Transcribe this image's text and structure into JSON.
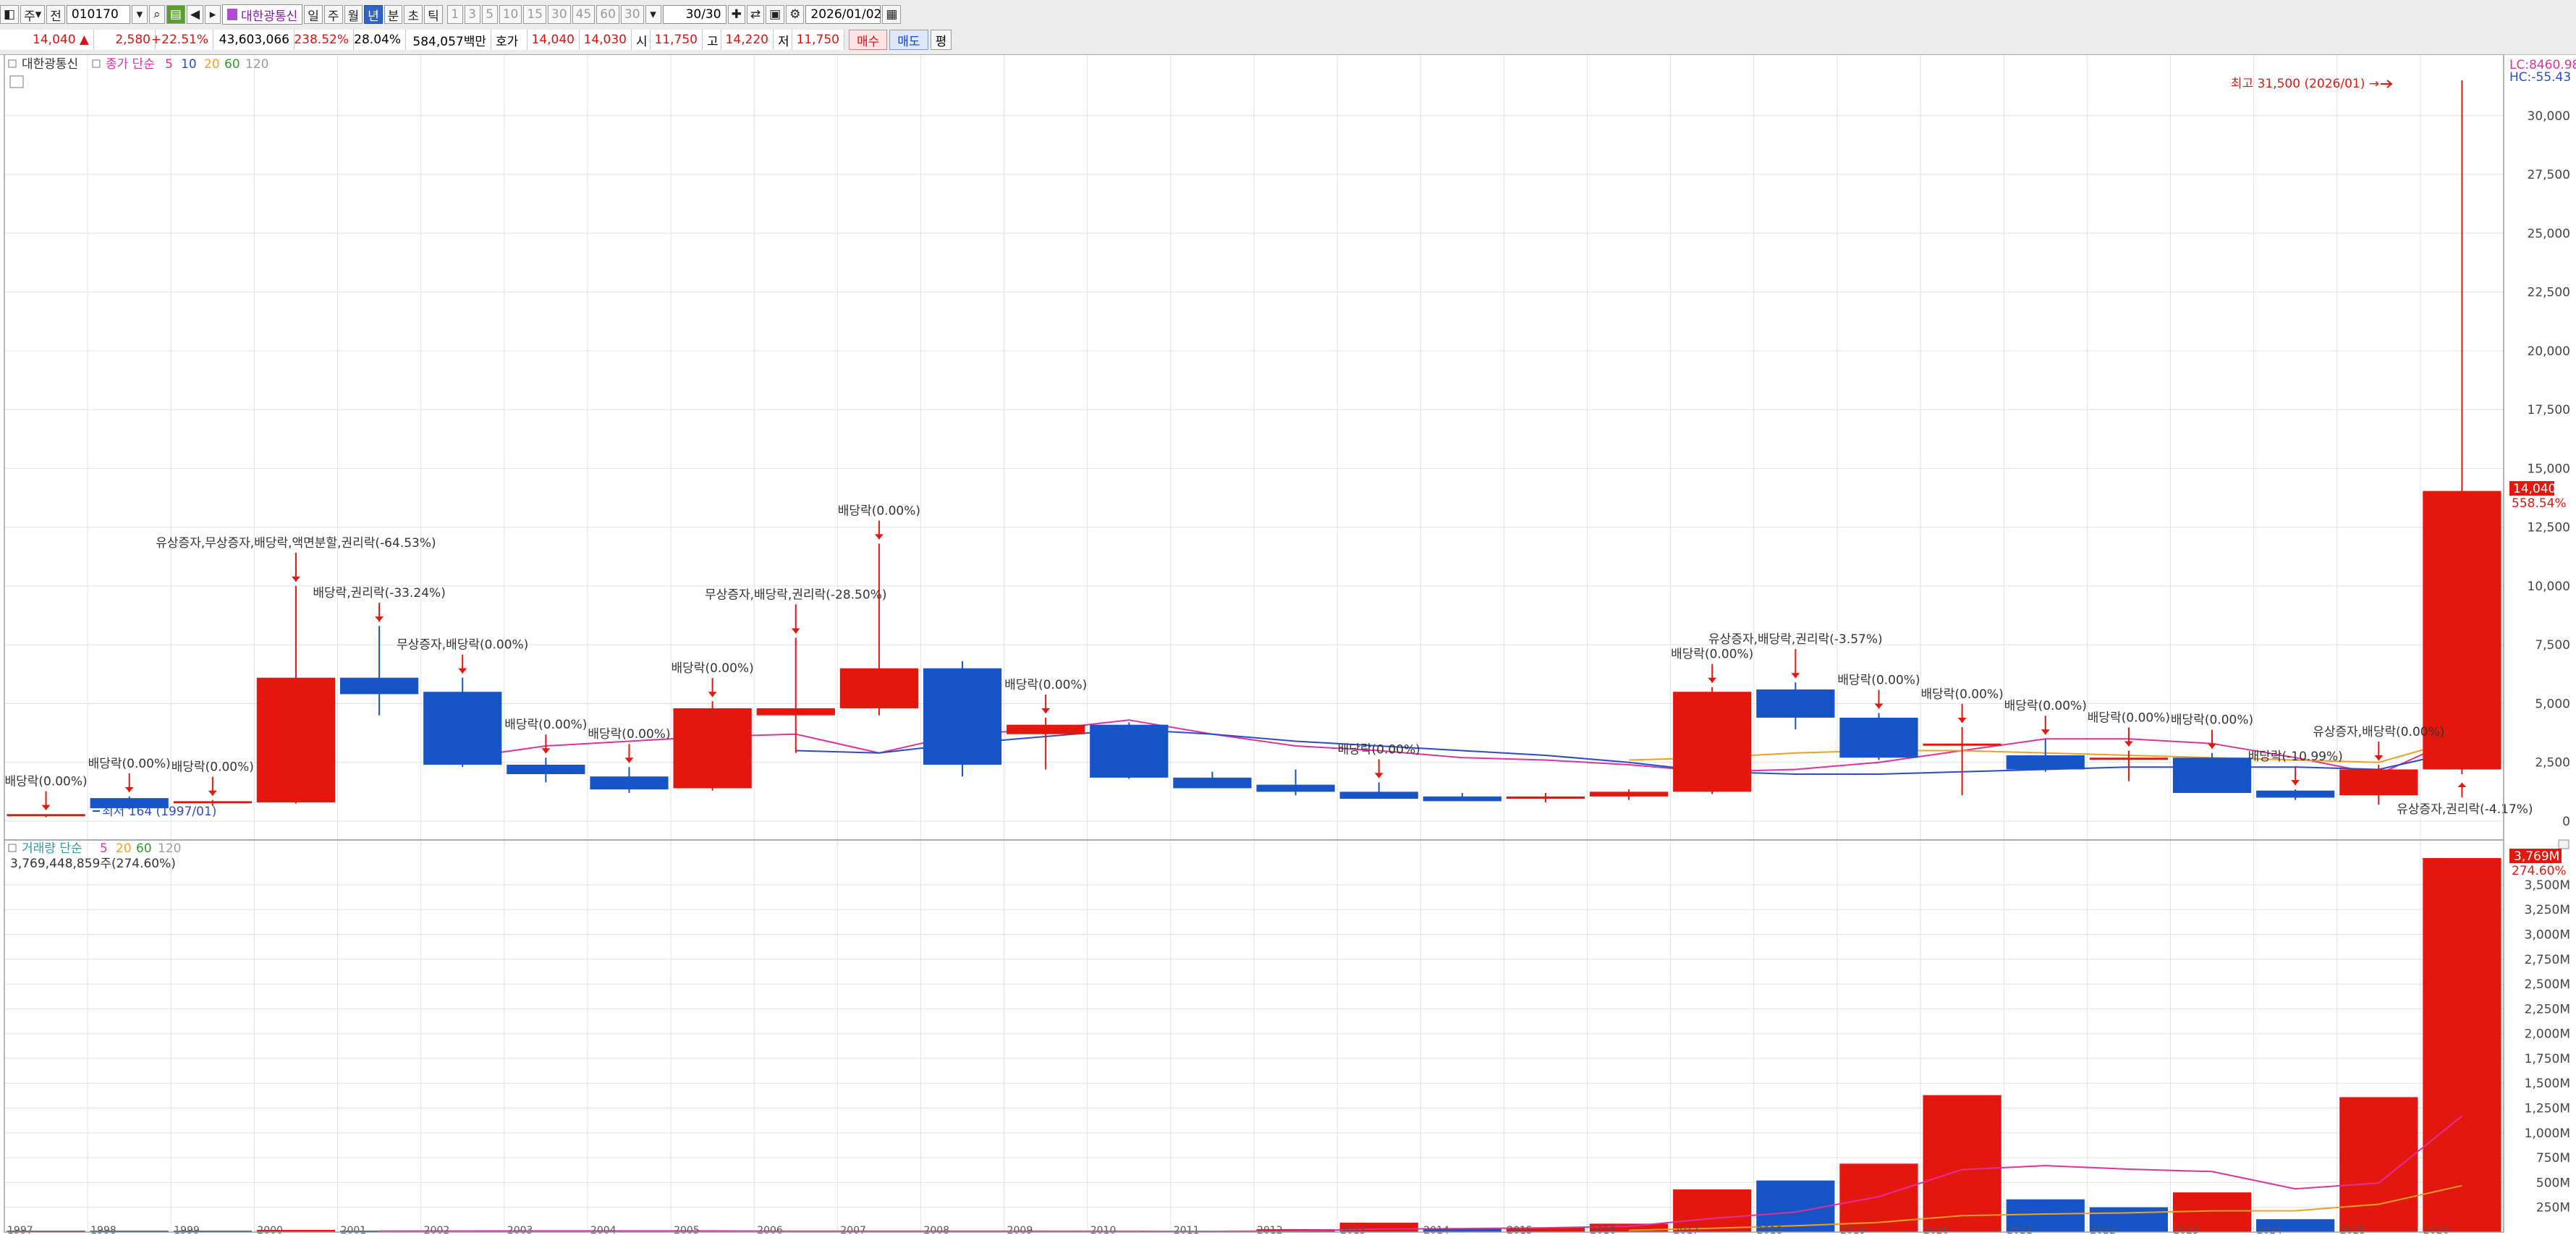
{
  "toolbar": {
    "period_unit": "주",
    "prev": "전",
    "code": "010170",
    "stock_name": "대한광통신",
    "intervals": [
      "일",
      "주",
      "월",
      "년",
      "분",
      "초",
      "틱"
    ],
    "active_interval": "년",
    "counts": [
      "1",
      "3",
      "5",
      "10",
      "15",
      "30",
      "45",
      "60",
      "30"
    ],
    "count_field": "30/30",
    "date": "2026/01/02"
  },
  "quote": {
    "price": "14,040 ▲",
    "change": "2,580",
    "change_pct": "+22.51%",
    "volume": "43,603,066",
    "volume_pct": "238.52%",
    "turnover": "28.04%",
    "amount": "584,057백만",
    "bid_label": "호가",
    "ask": "14,040",
    "bid": "14,030",
    "open_label": "시",
    "open": "11,750",
    "high_label": "고",
    "high": "14,220",
    "low_label": "저",
    "low": "11,750",
    "buy": "매수",
    "sell": "매도",
    "eval": "평"
  },
  "price_panel": {
    "title": "대한광통신",
    "ma_label": "종가 단순",
    "ma_periods": [
      "5",
      "10",
      "20",
      "60",
      "120"
    ],
    "lc": "LC:8460.98",
    "hc": "HC:-55.43",
    "high_note": "최고 31,500 (2026/01) →",
    "low_note": "최저 164 (1997/01)",
    "last_price": "14,040",
    "last_pct": "558.54%"
  },
  "volume_panel": {
    "title": "거래량 단순",
    "ma_periods": [
      "5",
      "20",
      "60",
      "120"
    ],
    "total": "3,769,448,859주(274.60%)",
    "last_value": "3,769M",
    "last_pct": "274.60%"
  },
  "colors": {
    "up": "#e3170e",
    "down": "#1654c8",
    "ma5": "#e0309c",
    "ma10": "#2a4cc8",
    "ma20": "#f0a020",
    "ma60": "#2e9a2e",
    "ma120": "#9a9a9a"
  },
  "chart_data": [
    {
      "type": "candlestick",
      "x": [
        "1997",
        "1998",
        "1999",
        "2000",
        "2001",
        "2002",
        "2003",
        "2004",
        "2005",
        "2006",
        "2007",
        "2008",
        "2009",
        "2010",
        "2011",
        "2012",
        "2013",
        "2014",
        "2015",
        "2016",
        "2017",
        "2018",
        "2019",
        "2020",
        "2021",
        "2022",
        "2023",
        "2024",
        "2025",
        "2026"
      ],
      "open": [
        250,
        980,
        850,
        800,
        6100,
        5500,
        2400,
        1900,
        1400,
        4500,
        4800,
        6500,
        3700,
        4100,
        1850,
        1550,
        1250,
        1050,
        950,
        1050,
        1250,
        5600,
        4400,
        3300,
        2800,
        2650,
        2700,
        1300,
        1100,
        2200
      ],
      "high": [
        290,
        1050,
        900,
        10000,
        8300,
        6100,
        2700,
        2300,
        5100,
        7800,
        11800,
        6800,
        4400,
        4200,
        2100,
        2200,
        1650,
        1200,
        1200,
        1350,
        5700,
        5900,
        4600,
        4000,
        3500,
        3000,
        2900,
        1350,
        2400,
        31500
      ],
      "low": [
        164,
        500,
        650,
        750,
        4500,
        2300,
        1650,
        1200,
        1300,
        2900,
        4500,
        1900,
        2200,
        1800,
        1400,
        1100,
        950,
        850,
        800,
        900,
        1150,
        3900,
        2600,
        1100,
        2100,
        1700,
        1200,
        900,
        700,
        2000
      ],
      "close": [
        300,
        550,
        850,
        6100,
        5400,
        2400,
        2000,
        1350,
        4800,
        4800,
        6500,
        2400,
        4100,
        1850,
        1400,
        1250,
        950,
        850,
        1050,
        1250,
        5500,
        4400,
        2700,
        3300,
        2200,
        2700,
        1200,
        1000,
        2200,
        14040
      ],
      "annotations": [
        {
          "x": "1997",
          "text": "배당락(0.00%)"
        },
        {
          "x": "1998",
          "text": "배당락(0.00%)"
        },
        {
          "x": "1999",
          "text": "배당락(0.00%)"
        },
        {
          "x": "2000",
          "text": "유상증자,무상증자,배당락,액면분할,권리락(-64.53%)"
        },
        {
          "x": "2001",
          "text": "배당락,권리락(-33.24%)"
        },
        {
          "x": "2002",
          "text": "무상증자,배당락(0.00%)"
        },
        {
          "x": "2003",
          "text": "배당락(0.00%)"
        },
        {
          "x": "2004",
          "text": "배당락(0.00%)"
        },
        {
          "x": "2005",
          "text": "배당락(0.00%)"
        },
        {
          "x": "2006",
          "text": "무상증자,배당락,권리락(-28.50%)"
        },
        {
          "x": "2007",
          "text": "배당락(0.00%)"
        },
        {
          "x": "2009",
          "text": "배당락(0.00%)"
        },
        {
          "x": "2013",
          "text": "배당락(0.00%)"
        },
        {
          "x": "2017",
          "text": "배당락(0.00%)"
        },
        {
          "x": "2018",
          "text": "유상증자,배당락,권리락(-3.57%)"
        },
        {
          "x": "2019",
          "text": "배당락(0.00%)"
        },
        {
          "x": "2020",
          "text": "배당락(0.00%)"
        },
        {
          "x": "2021",
          "text": "배당락(0.00%)"
        },
        {
          "x": "2022",
          "text": "배당락(0.00%)"
        },
        {
          "x": "2023",
          "text": "배당락(0.00%)"
        },
        {
          "x": "2024",
          "text": "배당락(-10.99%)"
        },
        {
          "x": "2025",
          "text": "유상증자,배당락(0.00%)"
        },
        {
          "x": "2026",
          "text": "유상증자,권리락(-4.17%)"
        }
      ],
      "ma": [
        {
          "name": "5",
          "values": [
            null,
            null,
            null,
            null,
            null,
            2700,
            3200,
            3400,
            3600,
            3700,
            2900,
            3700,
            3900,
            4300,
            3700,
            3200,
            3000,
            2700,
            2600,
            2400,
            2100,
            2200,
            2500,
            3000,
            3500,
            3500,
            3300,
            2700,
            2000,
            3600
          ]
        },
        {
          "name": "10",
          "values": [
            null,
            null,
            null,
            null,
            null,
            null,
            null,
            null,
            null,
            3000,
            2900,
            3300,
            3600,
            3900,
            3700,
            3400,
            3200,
            3000,
            2800,
            2500,
            2100,
            2000,
            2000,
            2100,
            2200,
            2300,
            2300,
            2300,
            2200,
            3000
          ]
        },
        {
          "name": "20",
          "values": [
            null,
            null,
            null,
            null,
            null,
            null,
            null,
            null,
            null,
            null,
            null,
            null,
            null,
            null,
            null,
            null,
            null,
            null,
            null,
            2600,
            2700,
            2900,
            3000,
            3000,
            2900,
            2800,
            2700,
            2600,
            2500,
            3500
          ]
        }
      ],
      "ylim": [
        0,
        31500
      ],
      "yticks": [
        0,
        2500,
        5000,
        7500,
        10000,
        12500,
        15000,
        17500,
        20000,
        22500,
        25000,
        27500,
        30000
      ]
    },
    {
      "type": "bar",
      "x": [
        "1997",
        "1998",
        "1999",
        "2000",
        "2001",
        "2002",
        "2003",
        "2004",
        "2005",
        "2006",
        "2007",
        "2008",
        "2009",
        "2010",
        "2011",
        "2012",
        "2013",
        "2014",
        "2015",
        "2016",
        "2017",
        "2018",
        "2019",
        "2020",
        "2021",
        "2022",
        "2023",
        "2024",
        "2025",
        "2026"
      ],
      "values": [
        3,
        5,
        4,
        22,
        14,
        9,
        8,
        7,
        12,
        10,
        10,
        8,
        7,
        6,
        6,
        30,
        95,
        35,
        45,
        85,
        430,
        520,
        690,
        1380,
        330,
        250,
        400,
        130,
        1360,
        3769
      ],
      "up": [
        true,
        false,
        false,
        true,
        false,
        false,
        false,
        false,
        true,
        true,
        true,
        false,
        true,
        false,
        false,
        true,
        true,
        false,
        true,
        true,
        true,
        false,
        true,
        true,
        false,
        false,
        true,
        false,
        true,
        true
      ],
      "ma": [
        {
          "name": "5",
          "values": [
            null,
            null,
            null,
            null,
            10,
            11,
            12,
            12,
            12,
            9,
            9,
            9,
            9,
            8,
            7,
            12,
            31,
            36,
            43,
            58,
            138,
            202,
            357,
            630,
            670,
            634,
            610,
            436,
            494,
            1170
          ]
        },
        {
          "name": "20",
          "values": [
            null,
            null,
            null,
            null,
            null,
            null,
            null,
            null,
            null,
            null,
            null,
            null,
            null,
            null,
            null,
            null,
            null,
            null,
            null,
            18,
            39,
            64,
            98,
            166,
            182,
            194,
            214,
            215,
            281,
            468
          ]
        }
      ],
      "unit": "M",
      "ylim": [
        0,
        3769
      ],
      "yticks": [
        250,
        500,
        750,
        1000,
        1250,
        1500,
        1750,
        2000,
        2250,
        2500,
        2750,
        3000,
        3250,
        3500
      ]
    }
  ]
}
